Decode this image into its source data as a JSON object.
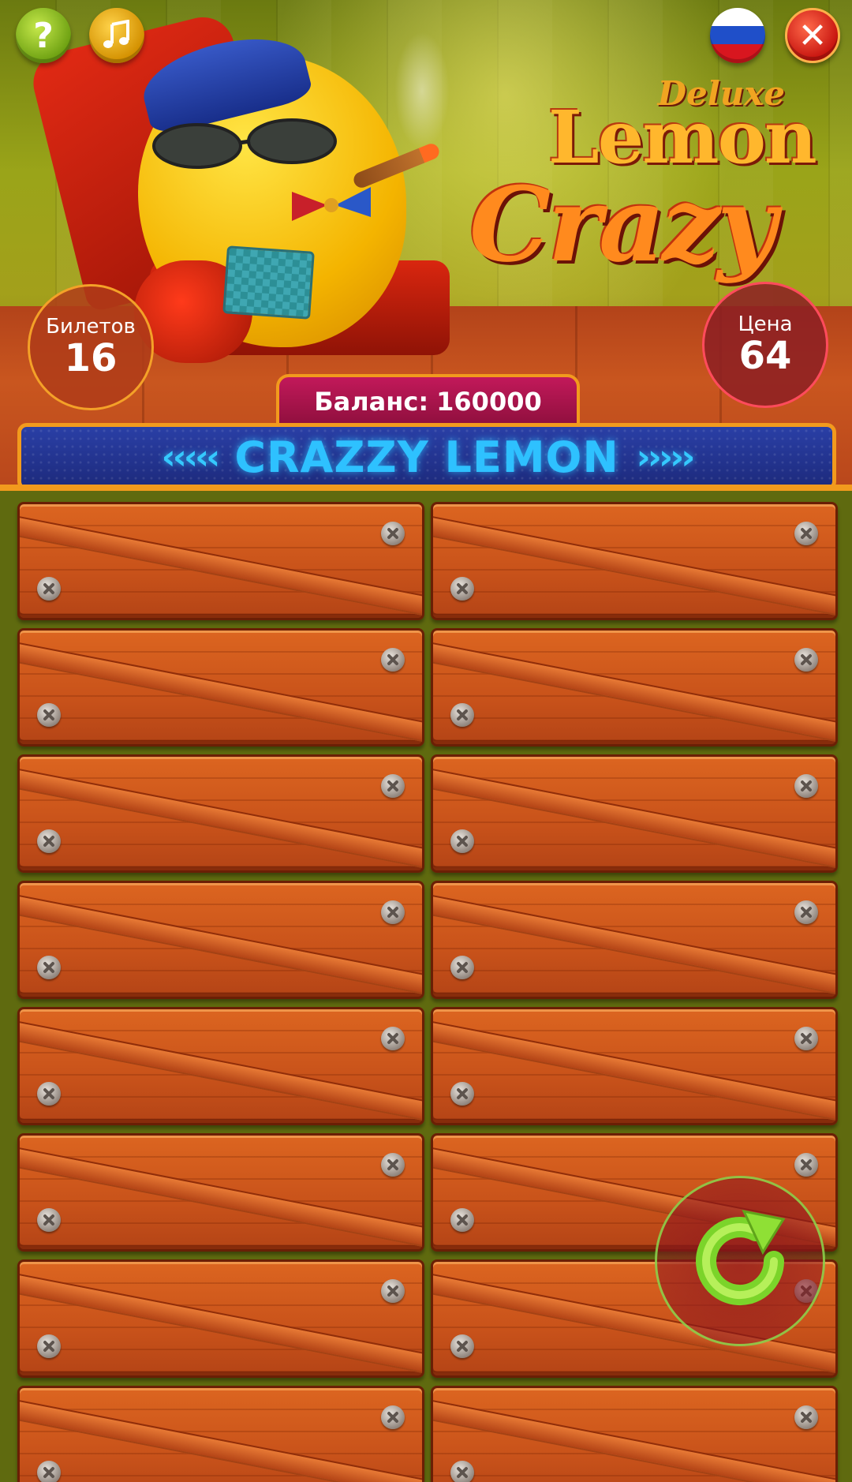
{
  "top_bar": {
    "help_label": "?",
    "music_icon": "music-note-icon",
    "language_icon": "russian-flag-icon",
    "close_label": "✕"
  },
  "logo": {
    "deluxe": "Deluxe",
    "lemon": "Lemon",
    "crazy": "Crazy"
  },
  "stats": {
    "tickets_label": "Билетов",
    "tickets_value": "16",
    "price_label": "Цена",
    "price_value": "64"
  },
  "balance": {
    "label": "Баланс:",
    "value": "160000"
  },
  "marquee": {
    "left_arrows": "‹‹‹‹‹",
    "text": "CRAZZY LEMON",
    "right_arrows": "›››››"
  },
  "tickets": {
    "count": 16,
    "state": "closed"
  },
  "refresh": {
    "icon": "refresh-icon"
  },
  "colors": {
    "accent_orange": "#f29a1d",
    "marquee_blue": "#2ec1ff",
    "balance_magenta": "#c2195a",
    "refresh_green": "#8fe035"
  }
}
